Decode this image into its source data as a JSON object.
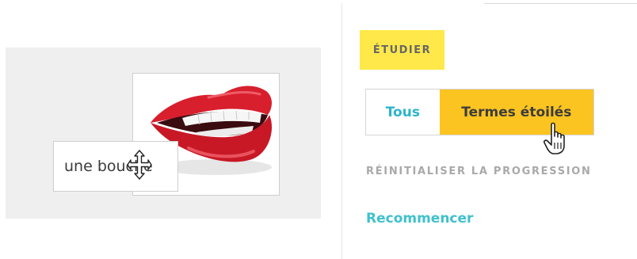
{
  "flashcard": {
    "term": "une bouche",
    "image_icon": "lips-image"
  },
  "study_panel": {
    "heading": "ÉTUDIER",
    "filters": [
      {
        "label": "Tous",
        "selected": false
      },
      {
        "label": "Termes étoilés",
        "selected": true
      }
    ],
    "reset_heading": "RÉINITIALISER LA PROGRESSION",
    "restart_link": "Recommencer"
  },
  "colors": {
    "highlight": "#ffe84a",
    "selected_filter": "#fcc421",
    "teal_link": "#2bb5c8",
    "card_area_bg": "#efefef"
  }
}
